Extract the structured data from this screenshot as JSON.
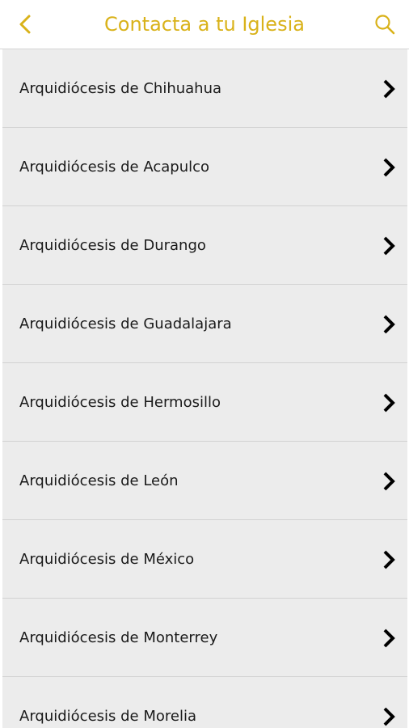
{
  "header": {
    "title": "Contacta a tu Iglesia",
    "back_icon": "chevron-left-icon",
    "search_icon": "search-icon",
    "accent_color": "#d9b21a"
  },
  "list": {
    "items": [
      {
        "label": "Arquidiócesis de Chihuahua"
      },
      {
        "label": "Arquidiócesis de Acapulco"
      },
      {
        "label": "Arquidiócesis de Durango"
      },
      {
        "label": "Arquidiócesis de Guadalajara"
      },
      {
        "label": "Arquidiócesis de Hermosillo"
      },
      {
        "label": "Arquidiócesis de León"
      },
      {
        "label": "Arquidiócesis de México"
      },
      {
        "label": "Arquidiócesis de Monterrey"
      },
      {
        "label": "Arquidiócesis de Morelia"
      }
    ],
    "item_icon": "chevron-right-icon",
    "item_background": "#ececec"
  }
}
